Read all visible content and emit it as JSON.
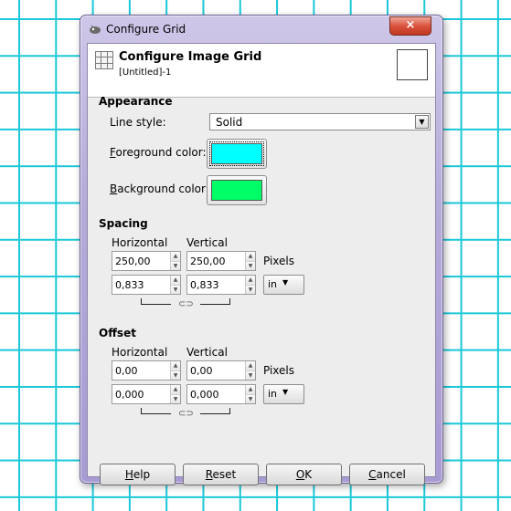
{
  "window": {
    "title": "Configure Grid",
    "close_glyph": "×"
  },
  "header": {
    "title": "Configure Image Grid",
    "subtitle": "[Untitled]-1"
  },
  "appearance": {
    "section_label": "Appearance",
    "line_style_label": "Line style:",
    "line_style_value": "Solid",
    "foreground_label_mnemonic": "F",
    "foreground_label_rest": "oreground color:",
    "foreground_color": "#00ffff",
    "background_label_mnemonic": "B",
    "background_label_rest": "ackground color:",
    "background_color": "#00ff66"
  },
  "spacing": {
    "section_label": "Spacing",
    "horizontal_label": "Horizontal",
    "vertical_label": "Vertical",
    "h_pixels": "250,00",
    "v_pixels": "250,00",
    "pixels_unit": "Pixels",
    "h_unit_value": "0,833",
    "v_unit_value": "0,833",
    "unit_select": "in"
  },
  "offset": {
    "section_label": "Offset",
    "horizontal_label": "Horizontal",
    "vertical_label": "Vertical",
    "h_pixels": "0,00",
    "v_pixels": "0,00",
    "pixels_unit": "Pixels",
    "h_unit_value": "0,000",
    "v_unit_value": "0,000",
    "unit_select": "in"
  },
  "buttons": {
    "help_m": "H",
    "help_r": "elp",
    "reset_m": "R",
    "reset_r": "eset",
    "ok_m": "O",
    "ok_r": "K",
    "cancel_m": "C",
    "cancel_r": "ancel"
  },
  "colors": {
    "grid_line": "#18c8d8",
    "window_frame": "#b5abd9",
    "close_button": "#d9533c"
  }
}
